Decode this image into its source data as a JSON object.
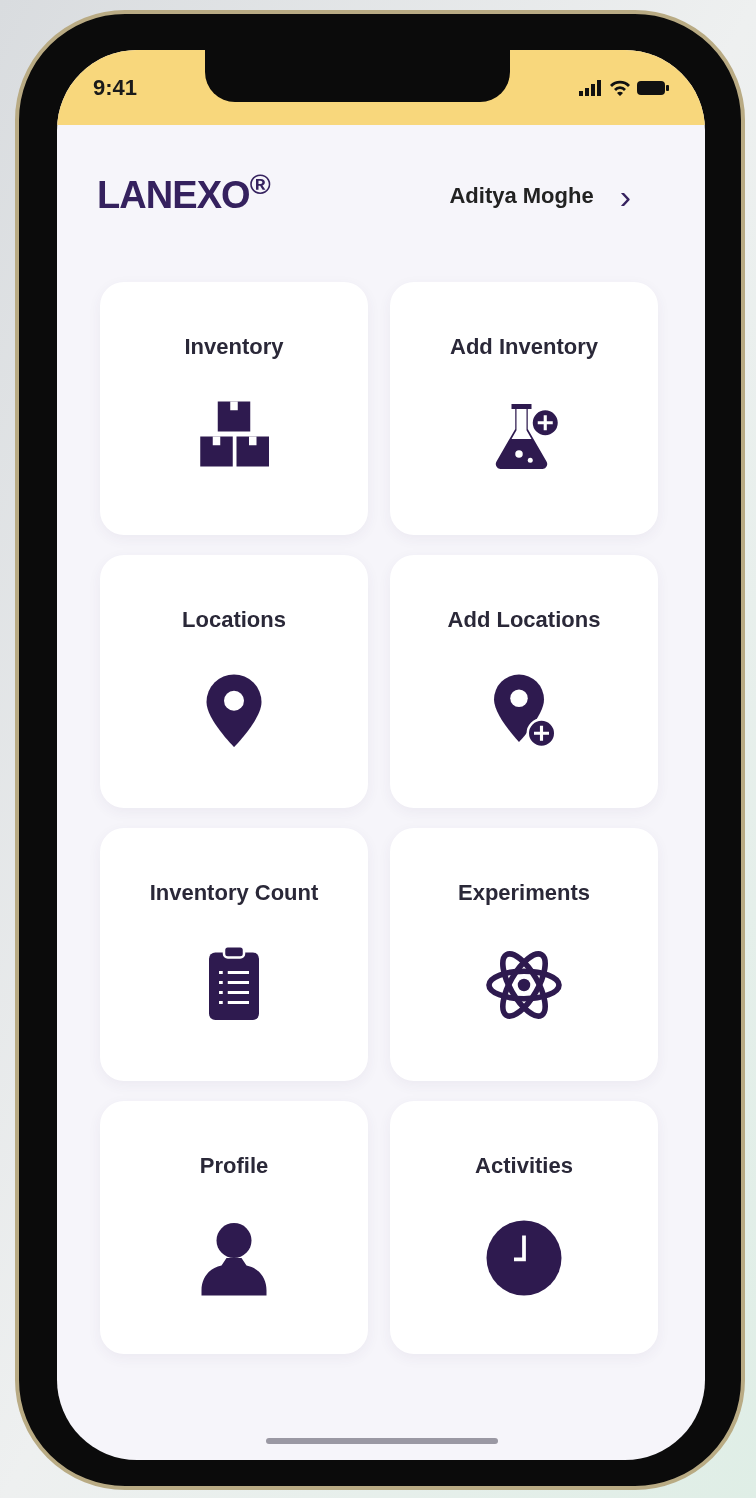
{
  "status_bar": {
    "time": "9:41"
  },
  "header": {
    "logo": "LANEXO$^{®}$",
    "user_name": "Aditya Moghe",
    "chevron": "›"
  },
  "tiles": [
    {
      "label": "Inventory"
    },
    {
      "label": "Add Inventory"
    },
    {
      "label": "Locations"
    },
    {
      "label": "Add Locations"
    },
    {
      "label": "Inventory Count"
    },
    {
      "label": "Experiments"
    },
    {
      "label": "Profile"
    },
    {
      "label": "Activities"
    }
  ]
}
